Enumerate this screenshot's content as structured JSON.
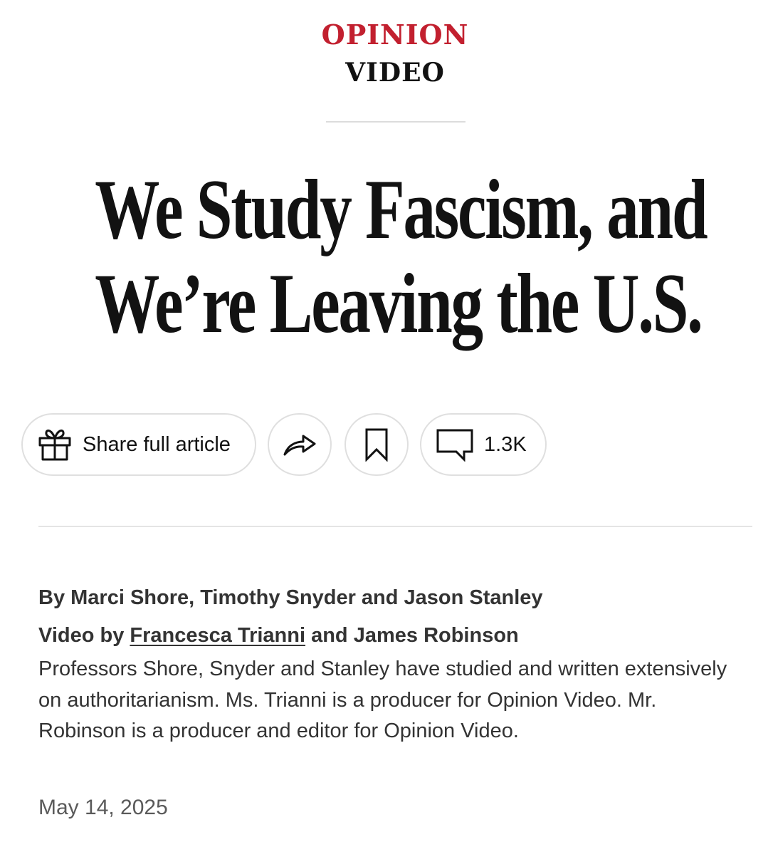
{
  "kicker": "OPINION",
  "subkicker": "VIDEO",
  "headline": {
    "line1": "We Study Fascism, and",
    "line2": "We’re Leaving the U.S."
  },
  "actions": {
    "share_full_label": "Share full article",
    "share_icon": "share-arrow-icon",
    "save_icon": "bookmark-icon",
    "gift_icon": "gift-icon",
    "comment_icon": "comment-bubble-icon",
    "comment_count": "1.3K"
  },
  "byline": {
    "authors": "By Marci Shore, Timothy Snyder and Jason Stanley",
    "video_prefix": "Video by",
    "video_author_link": "Francesca Trianni",
    "video_suffix": "and James Robinson",
    "bio": "Professors Shore, Snyder and Stanley have studied and written extensively on authoritarianism. Ms. Trianni is a producer for Opinion Video. Mr. Robinson is a producer and editor for Opinion Video."
  },
  "date": "May 14, 2025",
  "colors": {
    "kicker": "#c2202f",
    "text": "#121212",
    "border": "#dfdfdf"
  }
}
